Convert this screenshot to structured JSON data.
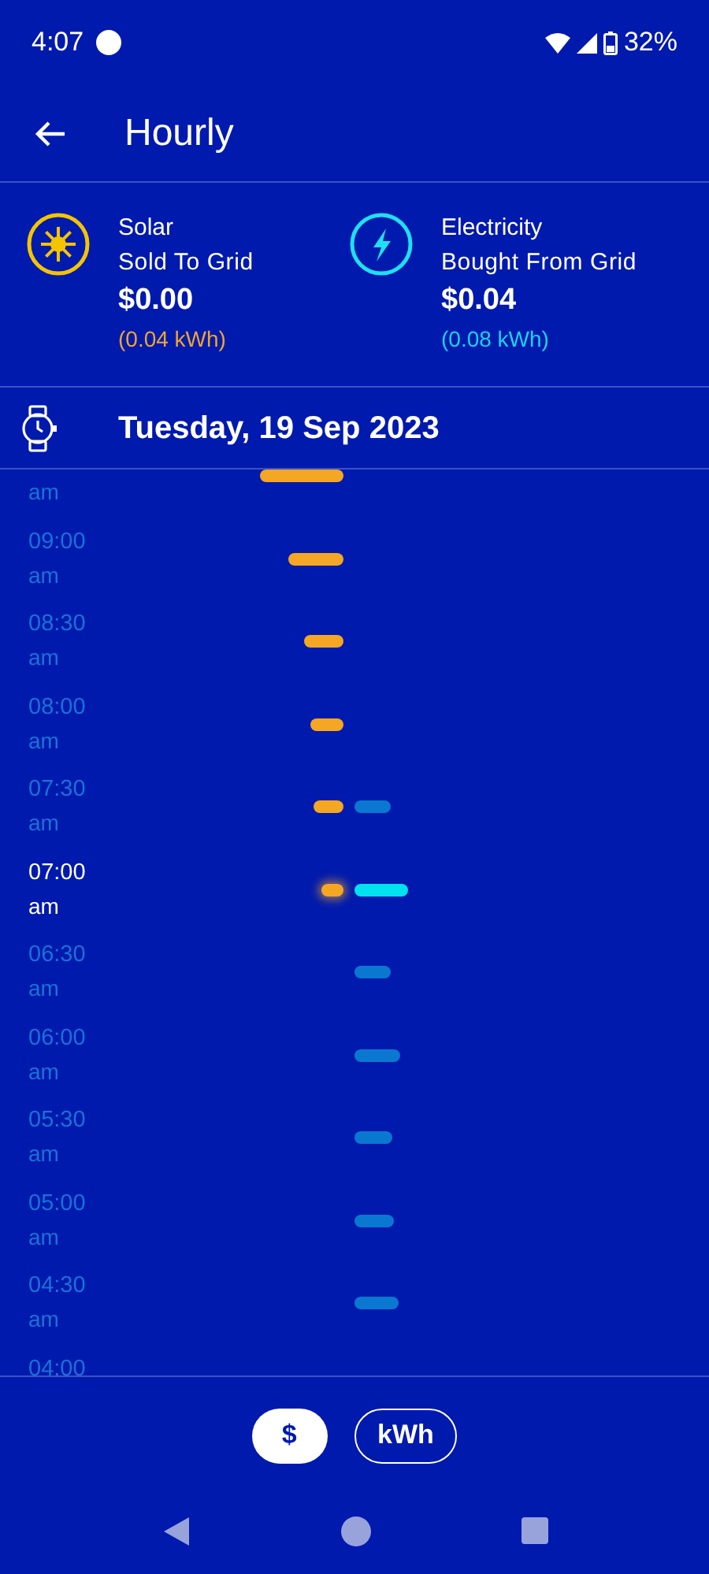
{
  "status_bar": {
    "time": "4:07",
    "battery": "32%"
  },
  "header": {
    "title": "Hourly"
  },
  "summary": [
    {
      "kind": "solar",
      "line1": "Solar",
      "line2": "Sold To Grid",
      "amount": "$0.00",
      "energy": "(0.04 kWh)"
    },
    {
      "kind": "grid",
      "line1": "Electricity",
      "line2": "Bought From Grid",
      "amount": "$0.04",
      "energy": "(0.08 kWh)"
    }
  ],
  "date": "Tuesday, 19 Sep 2023",
  "rows": [
    {
      "period": "am",
      "solar_bar": true,
      "grid_bar": false,
      "selected": false
    },
    {
      "time": "09:00",
      "period": "am",
      "solar_bar": true,
      "grid_bar": false,
      "selected": false
    },
    {
      "time": "08:30",
      "period": "am",
      "solar_bar": true,
      "grid_bar": false,
      "selected": false
    },
    {
      "time": "08:00",
      "period": "am",
      "solar_bar": true,
      "grid_bar": false,
      "selected": false
    },
    {
      "time": "07:30",
      "period": "am",
      "solar_bar": true,
      "grid_bar": true,
      "selected": false
    },
    {
      "time": "07:00",
      "period": "am",
      "solar_bar": true,
      "grid_bar": true,
      "selected": true
    },
    {
      "time": "06:30",
      "period": "am",
      "solar_bar": false,
      "grid_bar": true,
      "selected": false
    },
    {
      "time": "06:00",
      "period": "am",
      "solar_bar": false,
      "grid_bar": true,
      "selected": false
    },
    {
      "time": "05:30",
      "period": "am",
      "solar_bar": false,
      "grid_bar": true,
      "selected": false
    },
    {
      "time": "05:00",
      "period": "am",
      "solar_bar": false,
      "grid_bar": true,
      "selected": false
    },
    {
      "time": "04:30",
      "period": "am",
      "solar_bar": false,
      "grid_bar": true,
      "selected": false
    },
    {
      "time": "04:00",
      "selected": false
    }
  ],
  "units": [
    {
      "label": "$",
      "selected": true
    },
    {
      "label": "kWh",
      "selected": false
    }
  ]
}
